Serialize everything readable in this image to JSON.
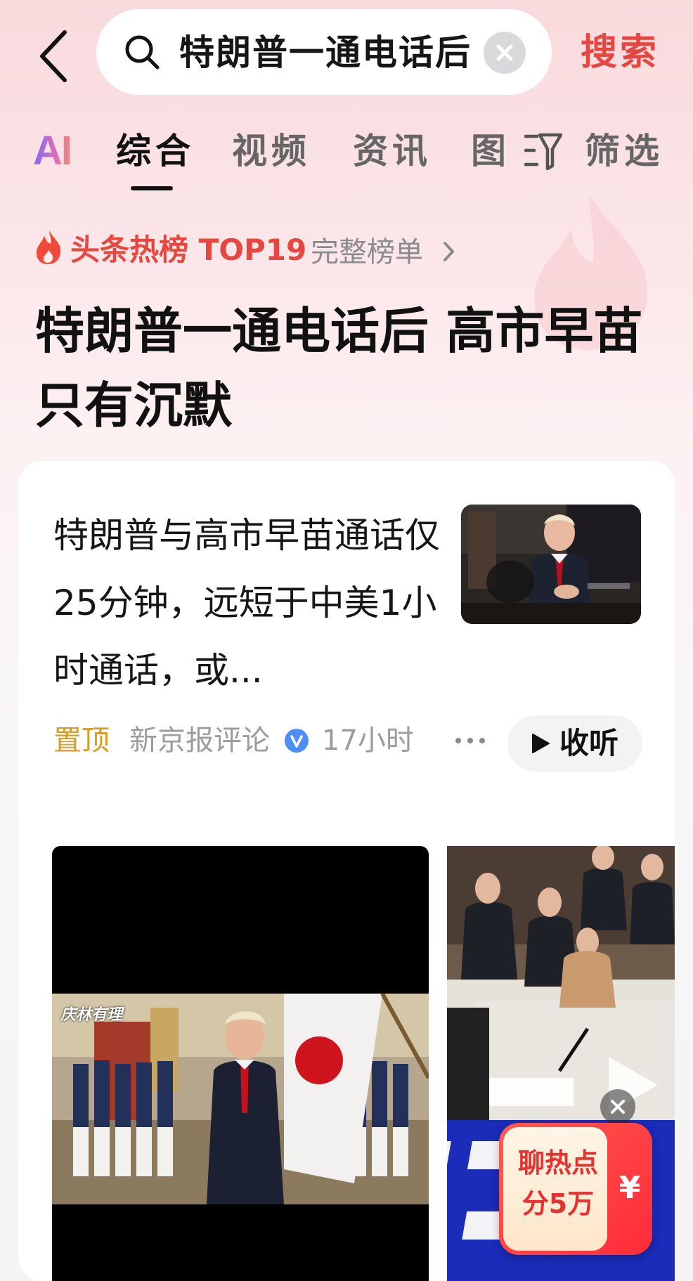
{
  "search": {
    "query": "特朗普一通电话后",
    "button_label": "搜索"
  },
  "tabs": {
    "ai_label": "AI",
    "items": [
      "综合",
      "视频",
      "资讯",
      "图"
    ],
    "filter_label": "筛选"
  },
  "hotlist": {
    "label": "头条热榜 TOP19",
    "full_link": "完整榜单"
  },
  "headline": "特朗普一通电话后 高市早苗只有沉默",
  "article": {
    "title": "特朗普与高市早苗通话仅25分钟，远短于中美1小时通话，或...",
    "pinned_label": "置顶",
    "source": "新京报评论",
    "time": "17小时",
    "listen_label": "收听"
  },
  "video": {
    "overlay_logo": "庆林有理"
  },
  "promo": {
    "line1": "聊热点",
    "line2": "分5万",
    "currency": "¥"
  },
  "colors": {
    "accent_red": "#e64640",
    "pinned_gold": "#d99b22",
    "verified_blue": "#4f8ef7"
  }
}
